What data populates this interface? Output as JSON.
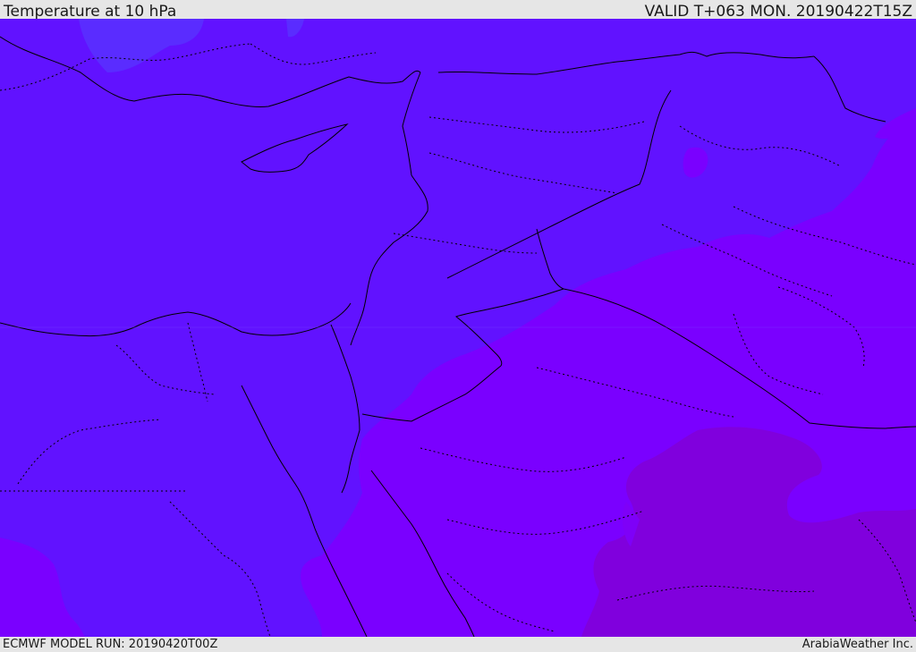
{
  "header": {
    "title": "Temperature at 10 hPa",
    "valid": "VALID T+063 MON. 20190422T15Z"
  },
  "footer": {
    "model_run": "ECMWF MODEL RUN: 20190420T00Z",
    "credit": "ArabiaWeather Inc."
  },
  "map": {
    "colors": {
      "contour_base": "#6112ff",
      "contour_light": "#5a2cff",
      "contour_warm": "#7a00ff",
      "contour_warmer": "#7e00f8",
      "contour_warmest": "#8000dd",
      "border_line": "#000000"
    }
  }
}
